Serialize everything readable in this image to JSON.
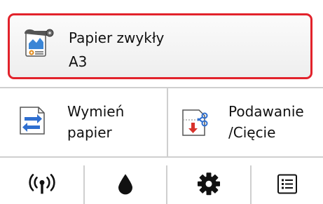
{
  "paper": {
    "type": "Papier zwykły",
    "size": "A3"
  },
  "actions": [
    {
      "line1": "Wymień",
      "line2": "papier",
      "icon": "replace-paper-icon"
    },
    {
      "line1": "Podawanie",
      "line2": "/Cięcie",
      "icon": "feed-cut-icon"
    }
  ],
  "bottom_bar": [
    {
      "icon": "wireless-icon"
    },
    {
      "icon": "ink-drop-icon"
    },
    {
      "icon": "gear-icon"
    },
    {
      "icon": "menu-list-icon"
    }
  ],
  "colors": {
    "highlight_border": "#e2222b",
    "arrow_blue": "#2f6fd0",
    "arrow_red": "#d8322c"
  }
}
